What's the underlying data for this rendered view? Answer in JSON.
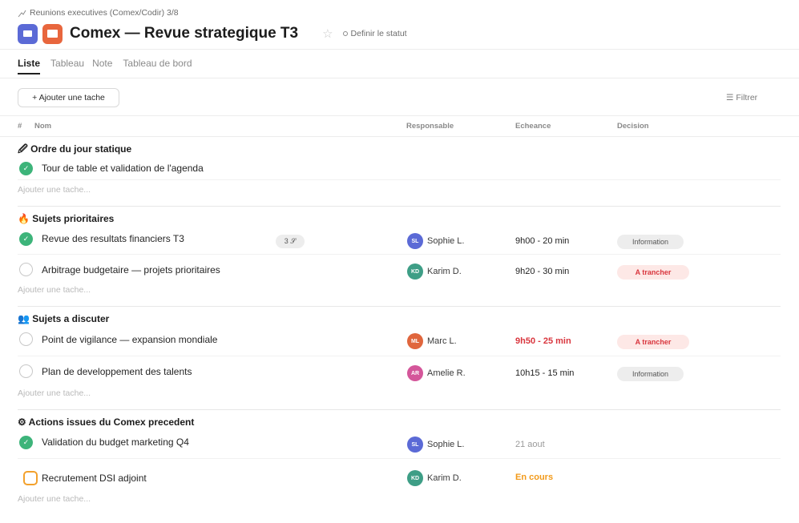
{
  "breadcrumb": {
    "icon": "chart-line-icon",
    "text": "Reunions executives (Comex/Codir) 3/8"
  },
  "header": {
    "title": "Comex — Revue strategique T3",
    "star_icon": "☆",
    "status_label": "Definir le statut"
  },
  "tabs": [
    "Liste",
    "Tableau",
    "Note",
    "Tableau de bord"
  ],
  "active_tab": "Liste",
  "toolbar": {
    "add_task": "+ Ajouter une tache",
    "filter": "☰ Filtrer"
  },
  "columns": {
    "num": "#",
    "name": "Nom",
    "owner": "Responsable",
    "due": "Echeance",
    "decision": "Decision"
  },
  "add_task_placeholder": "Ajouter une tache...",
  "sections": [
    {
      "icon": "🖉",
      "title": "Ordre du jour statique",
      "tasks": [
        {
          "name": "Tour de table et validation de l'agenda",
          "status": "done",
          "owner": "",
          "initials": "",
          "due": "",
          "decision": ""
        }
      ]
    },
    {
      "icon": "🔥",
      "title": "Sujets prioritaires",
      "tasks": [
        {
          "name": "Revue des resultats financiers T3",
          "status": "done",
          "subtasks": "3 𝒮",
          "owner": "Sophie L.",
          "initials": "SL",
          "due": "9h00 - 20 min",
          "decision": "Information"
        },
        {
          "name": "Arbitrage budgetaire — projets prioritaires",
          "status": "todo",
          "owner": "Karim D.",
          "initials": "KD",
          "due": "9h20 - 30 min",
          "decision": "A trancher"
        }
      ]
    },
    {
      "icon": "👥",
      "title": "Sujets a discuter",
      "tasks": [
        {
          "name": "Point de vigilance — expansion mondiale",
          "status": "todo",
          "owner": "Marc L.",
          "initials": "ML",
          "due": "9h50 - 25 min",
          "decision": "A trancher"
        },
        {
          "name": "Plan de developpement des talents",
          "status": "todo",
          "owner": "Amelie R.",
          "initials": "AR",
          "due": "10h15 - 15 min",
          "decision": "Information"
        }
      ]
    },
    {
      "icon": "⚙",
      "title": "Actions issues du Comex precedent",
      "tasks": [
        {
          "name": "Validation du budget marketing Q4",
          "status": "done",
          "owner": "Sophie L.",
          "initials": "SL",
          "due": "21 aout",
          "decision": ""
        },
        {
          "name": "Recrutement DSI adjoint",
          "status": "in-progress",
          "owner": "Karim D.",
          "initials": "KD",
          "due": "En cours",
          "decision": ""
        }
      ]
    }
  ],
  "colors": {
    "done": "#3db47a",
    "late": "#d9363e",
    "in_progress": "#f29a1a",
    "avatar_SL": "#5b6ad6",
    "avatar_KD": "#3e9e86",
    "avatar_ML": "#e0663d",
    "avatar_AR": "#d4569a"
  }
}
